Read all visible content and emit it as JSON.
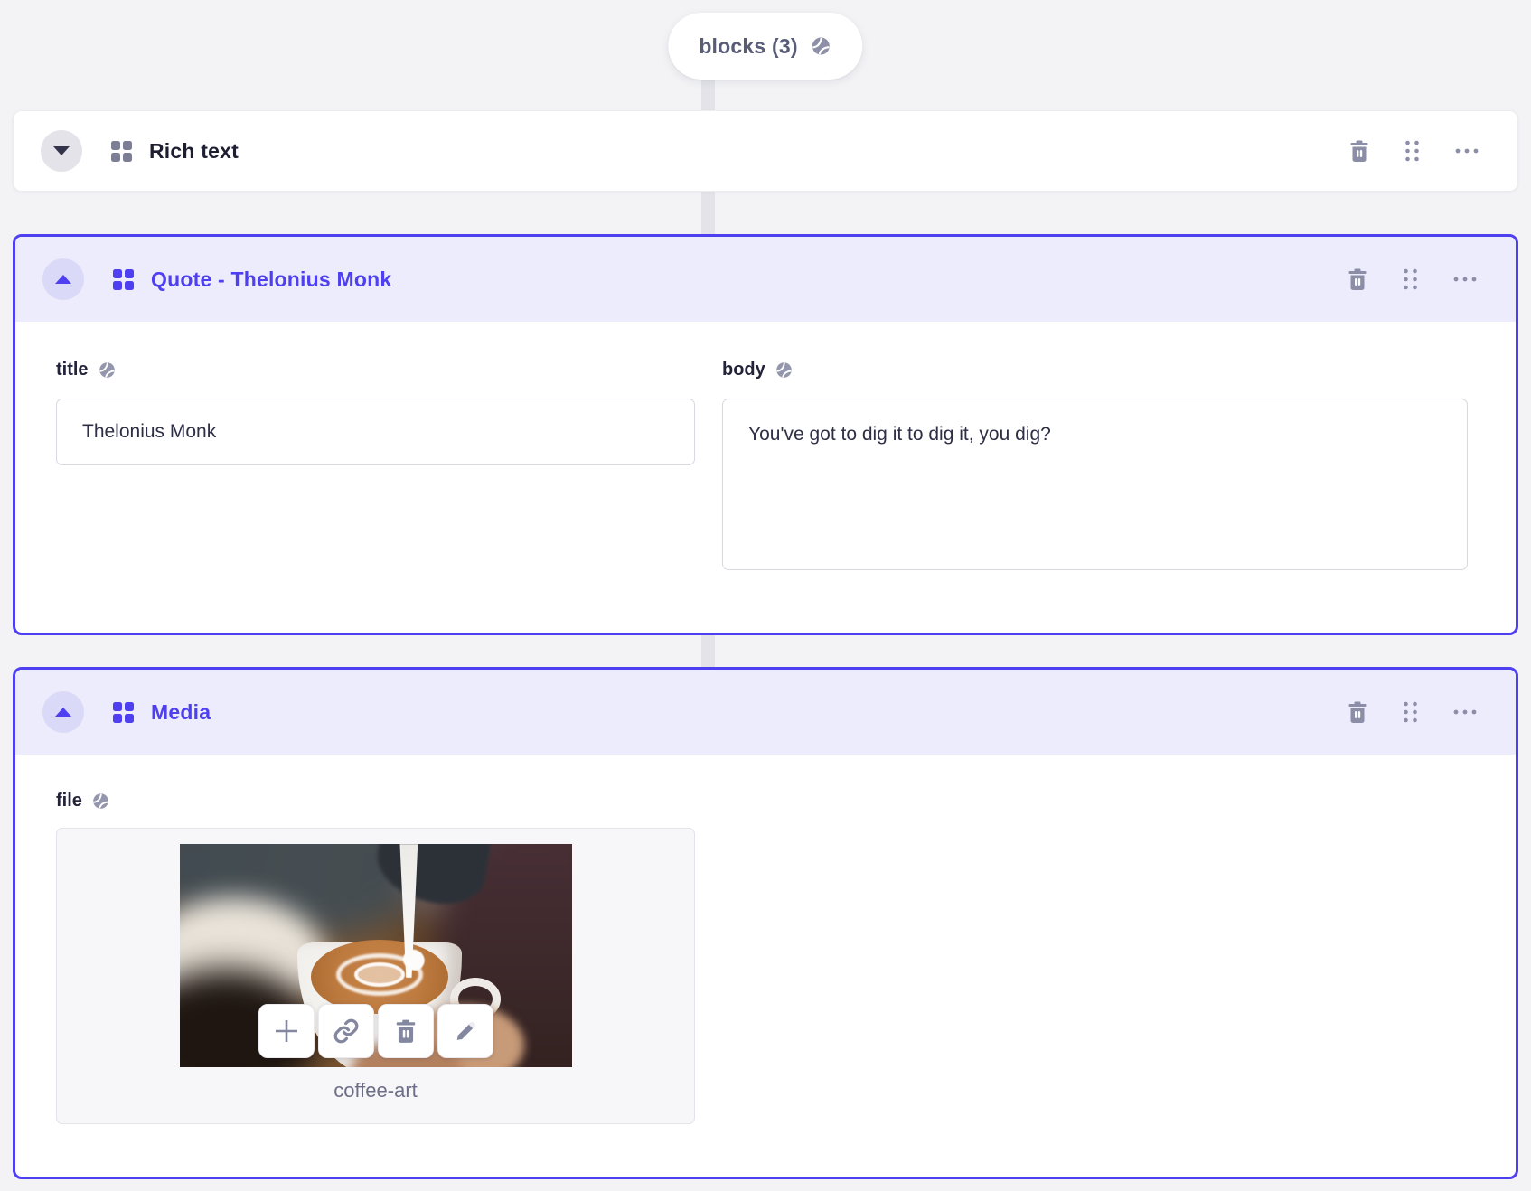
{
  "colors": {
    "accent": "#4e3ff0",
    "accent_header_bg": "#ececfc",
    "page_bg": "#f3f3f6",
    "connector": "#e3e3e9",
    "icon_gray": "#8b8ea6",
    "text_dark": "#1d1e32"
  },
  "pill": {
    "label": "blocks (3)",
    "icon": "globe-icon"
  },
  "icons": {
    "toggle_collapsed": "chevron-down-icon",
    "toggle_expanded": "chevron-up-icon",
    "block_type": "blocks-grid-icon",
    "delete": "trash-icon",
    "drag": "drag-handle-icon",
    "more": "ellipsis-icon",
    "translatable": "globe-icon"
  },
  "blocks": [
    {
      "title": "Rich text",
      "state": "collapsed"
    },
    {
      "title": "Quote - Thelonius Monk",
      "state": "expanded",
      "fields": {
        "title": {
          "label": "title",
          "value": "Thelonius Monk"
        },
        "body": {
          "label": "body",
          "value": "You've got to dig it to dig it, you dig?"
        }
      }
    },
    {
      "title": "Media",
      "state": "expanded",
      "fields": {
        "file": {
          "label": "file",
          "file_name": "coffee-art",
          "toolbar_icons": [
            "plus-icon",
            "link-icon",
            "trash-icon",
            "pencil-icon"
          ]
        }
      }
    }
  ]
}
